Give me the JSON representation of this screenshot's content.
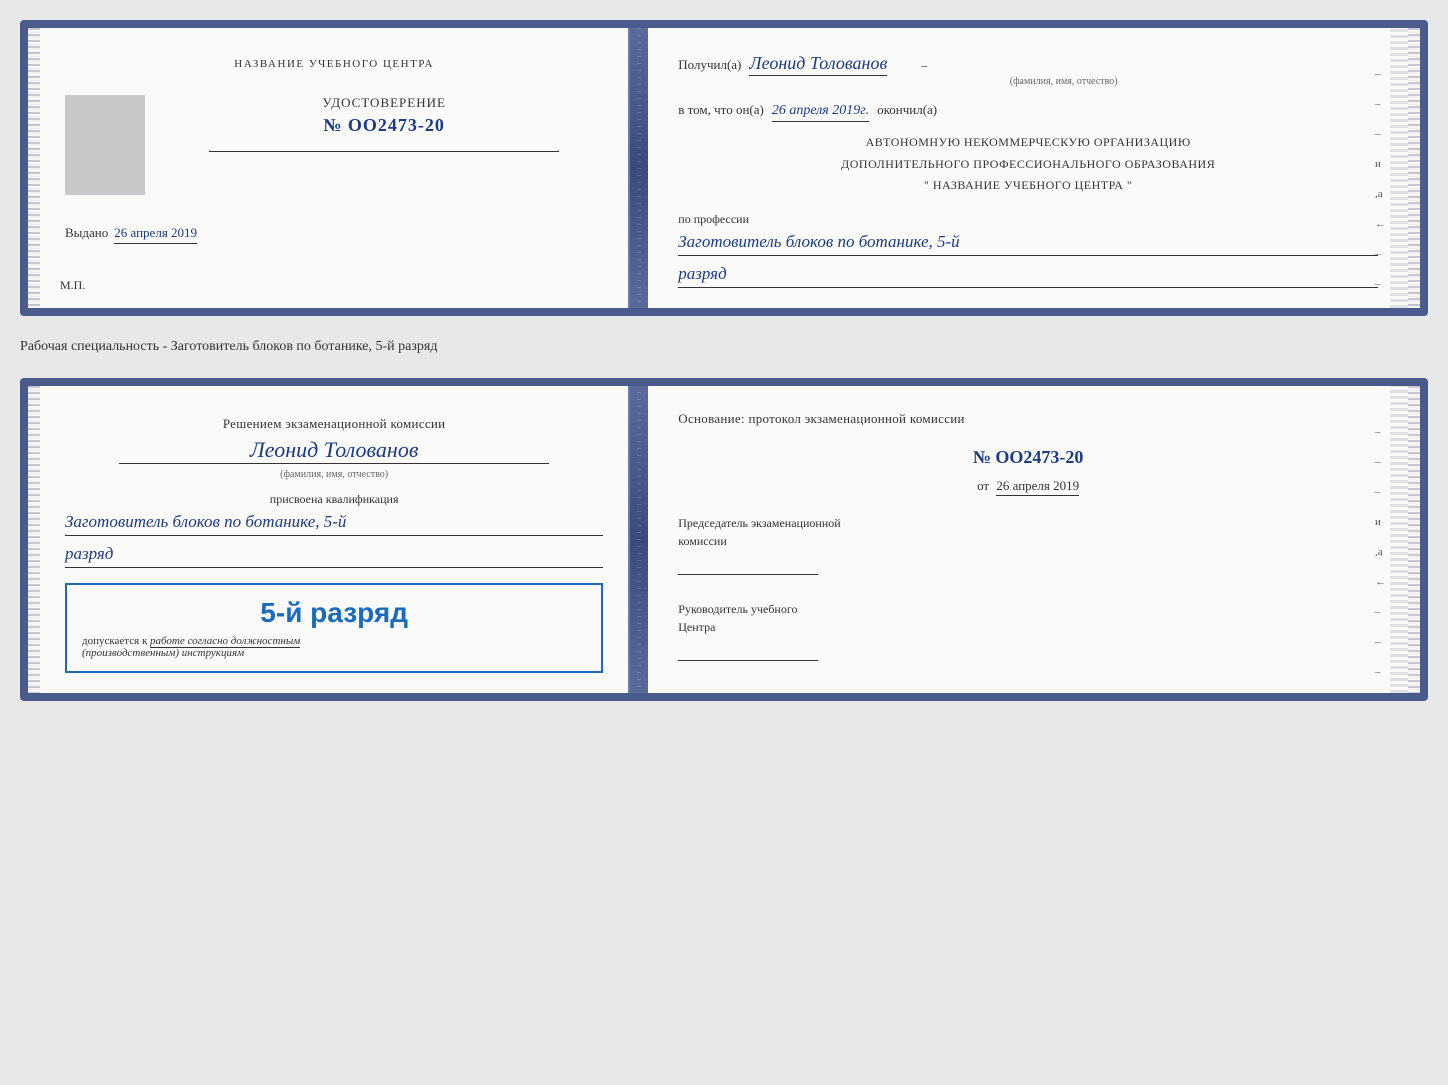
{
  "doc1": {
    "left": {
      "center_title": "НАЗВАНИЕ УЧЕБНОГО ЦЕНТРА",
      "cert_label": "УДОСТОВЕРЕНИЕ",
      "cert_number": "№ OO2473-20",
      "issued_prefix": "Выдано",
      "issued_date": "26 апреля 2019",
      "mp_label": "М.П."
    },
    "right": {
      "recipient_prefix": "Получил(а)",
      "recipient_name": "Леонид Толованов",
      "sub_label": "(фамилия, имя, отчество)",
      "confirm_prefix": "в том, что он(а)",
      "confirm_date": "26 апреля 2019г.",
      "confirm_suffix": "окончил(а)",
      "org_line1": "АВТОНОМНУЮ НЕКОММЕРЧЕСКУЮ ОРГАНИЗАЦИЮ",
      "org_line2": "ДОПОЛНИТЕЛЬНОГО ПРОФЕССИОНАЛЬНОГО ОБРАЗОВАНИЯ",
      "org_name": "\" НАЗВАНИЕ УЧЕБНОГО ЦЕНТРА \"",
      "profession_label": "по профессии",
      "profession_value": "Заготовитель блоков по ботанике, 5-й",
      "rank_value": "разряд"
    }
  },
  "between_label": "Рабочая специальность - Заготовитель блоков по ботанике, 5-й разряд",
  "doc2": {
    "left": {
      "decision_text": "Решением экзаменационной комиссии",
      "person_name": "Леонид Толованов",
      "sub_label": "(фамилия, имя, отчество)",
      "qualification_label": "присвоена квалификация",
      "qualification_value": "Заготовитель блоков по ботанике, 5-й",
      "rank_value": "разряд",
      "stamp_rank": "5-й разряд",
      "stamp_allowed": "допускается к",
      "stamp_work": "работе согласно должностным",
      "stamp_instructions": "(производственным) инструкциям"
    },
    "right": {
      "basis_label": "Основание: протокол экзаменационной комиссии",
      "protocol_number": "№ OO2473-20",
      "from_prefix": "от",
      "from_date": "26 апреля 2019",
      "chairman_label": "Председатель экзаменационной",
      "chairman_label2": "комиссии",
      "head_label": "Руководитель учебного",
      "head_label2": "Центра"
    }
  },
  "dash_labels": [
    "-",
    "-",
    "-",
    "и",
    ",а",
    "←",
    "-",
    "-",
    "-",
    "-"
  ],
  "dash_labels2": [
    "-",
    "-",
    "-",
    "и",
    ",а",
    "←",
    "-",
    "-",
    "-",
    "-"
  ]
}
